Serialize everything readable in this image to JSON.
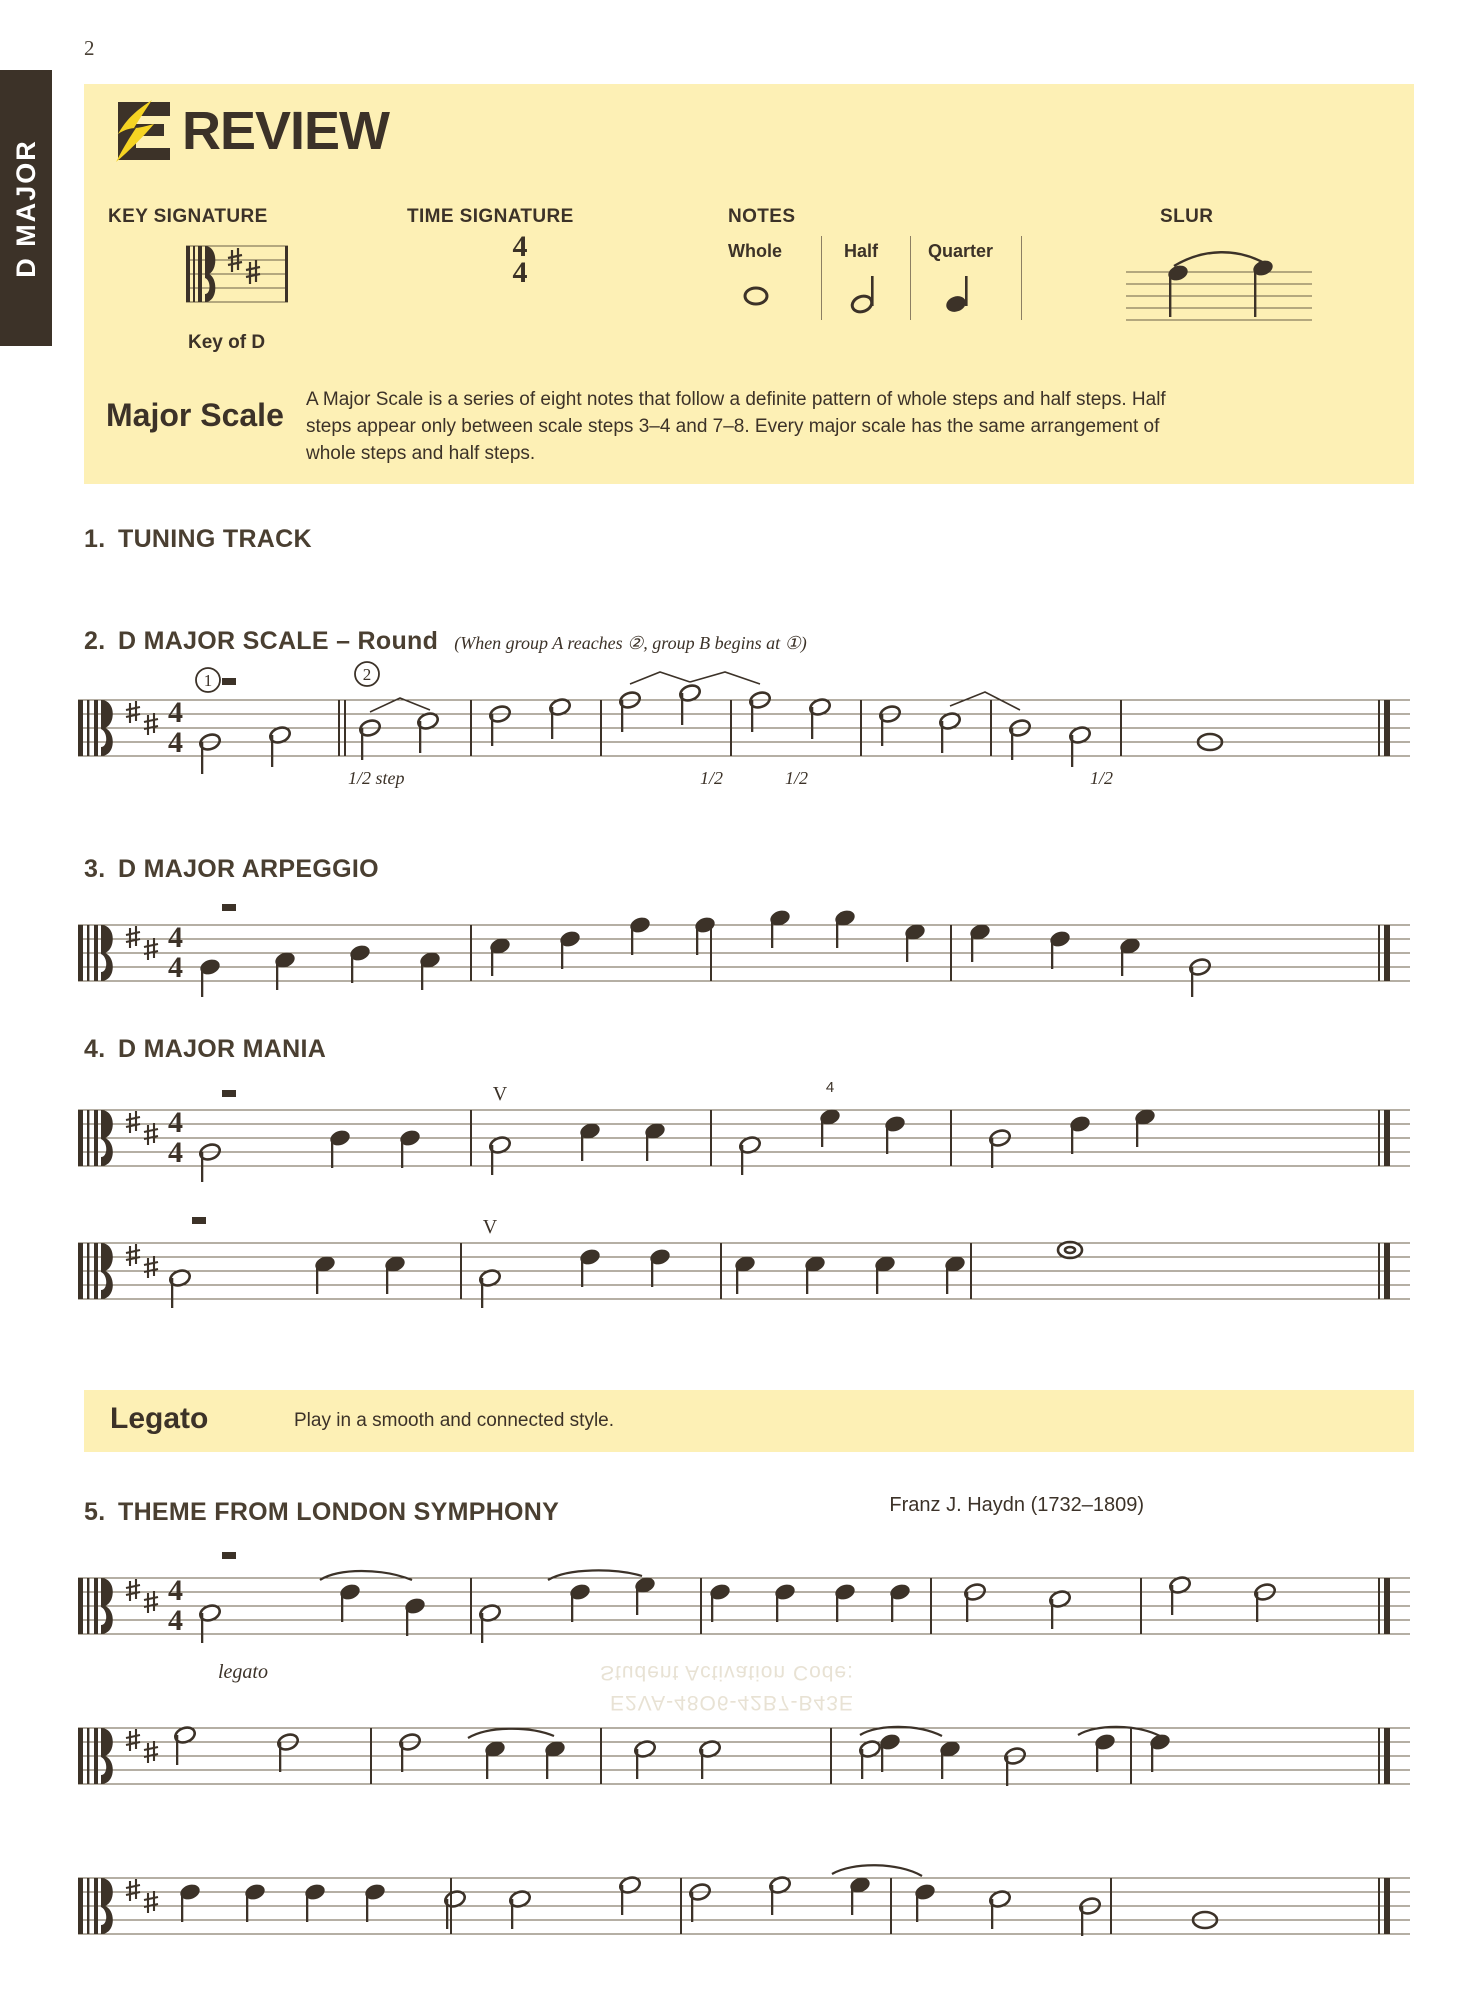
{
  "page": {
    "number": "2",
    "side_tab_label": "D MAJOR"
  },
  "review": {
    "title": "REVIEW",
    "logo_icon": "lightning-e-icon",
    "columns": {
      "key_signature": "KEY SIGNATURE",
      "time_signature": "TIME SIGNATURE",
      "notes": "NOTES",
      "slur": "SLUR"
    },
    "key_of": "Key of D",
    "time_signature_top": "4",
    "time_signature_bottom": "4",
    "note_labels": [
      "Whole",
      "Half",
      "Quarter"
    ],
    "major_scale": {
      "heading": "Major Scale",
      "body": "A Major Scale is a series of eight notes that follow a definite pattern of whole steps and half steps. Half steps appear only between scale steps 3–4 and 7–8. Every major scale has the same arrangement of whole steps and half steps."
    }
  },
  "exercises": [
    {
      "number": "1.",
      "title": "TUNING TRACK",
      "subtitle": "",
      "composer": ""
    },
    {
      "number": "2.",
      "title": "D MAJOR SCALE – Round",
      "subtitle": "(When group A reaches ②, group B begins at ①)",
      "composer": "",
      "step_marks": [
        "1/2 step",
        "1/2",
        "1/2",
        "1/2"
      ],
      "rehearsal_marks": [
        "①",
        "②"
      ]
    },
    {
      "number": "3.",
      "title": "D MAJOR ARPEGGIO",
      "subtitle": "",
      "composer": ""
    },
    {
      "number": "4.",
      "title": "D MAJOR MANIA",
      "subtitle": "",
      "composer": "",
      "fingering": "4"
    },
    {
      "number": "5.",
      "title": "THEME FROM LONDON SYMPHONY",
      "subtitle": "",
      "composer": "Franz J. Haydn (1732–1809)",
      "dynamic": "legato"
    }
  ],
  "legato": {
    "heading": "Legato",
    "body": "Play in a smooth and connected style."
  },
  "watermark": {
    "line1": "Student Activation Code:",
    "line2": "E2VA-48O6-42B7-B43E"
  },
  "colors": {
    "banner_bg": "#fdf0b5",
    "ink": "#3c3228",
    "tab_bg": "#3c3228",
    "logo_yellow": "#f5d423",
    "paper": "#ffffff"
  }
}
